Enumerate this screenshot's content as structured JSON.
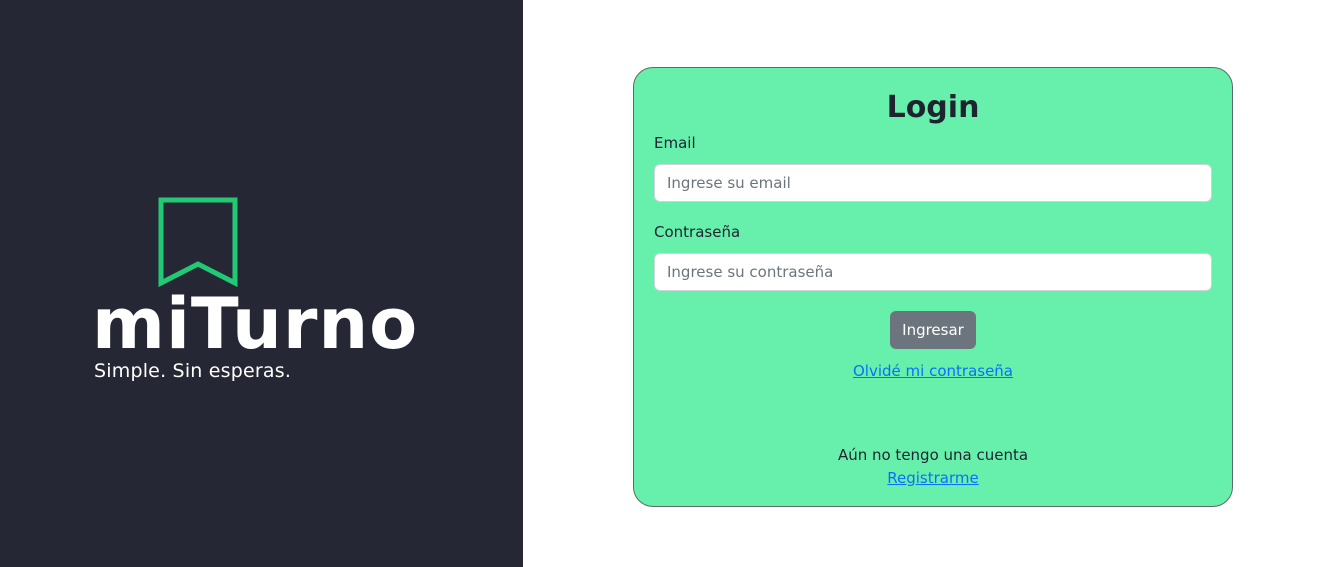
{
  "brand": {
    "name": "miTurno",
    "tagline": "Simple. Sin esperas.",
    "accent_color": "#22c975",
    "icon": "bookmark-icon"
  },
  "login": {
    "title": "Login",
    "email_label": "Email",
    "email_placeholder": "Ingrese su email",
    "email_value": "",
    "password_label": "Contraseña",
    "password_placeholder": "Ingrese su contraseña",
    "password_value": "",
    "submit_label": "Ingresar",
    "forgot_link": "Olvidé mi contraseña",
    "no_account_text": "Aún no tengo una cuenta",
    "register_link": "Registrarme",
    "card_color": "#67f0ab"
  }
}
